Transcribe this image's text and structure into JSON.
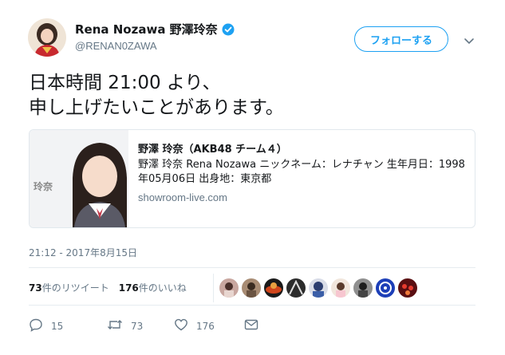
{
  "user": {
    "display_name": "Rena Nozawa 野澤玲奈",
    "handle": "@RENAN0ZAWA"
  },
  "follow_button": {
    "label": "フォローする"
  },
  "tweet": {
    "lines": [
      "日本時間 21:00 より、",
      "申し上げたいことがあります。"
    ]
  },
  "card": {
    "image_label": "玲奈",
    "title": "野澤 玲奈（AKB48 チーム４）",
    "description": "野澤 玲奈 Rena Nozawa ニックネーム：レナチャン 生年月日：1998年05月06日 出身地：東京都",
    "domain": "showroom-live.com"
  },
  "timestamp": "21:12 - 2017年8月15日",
  "stats": {
    "retweets_count": "73",
    "retweets_label": "件のリツイート",
    "likes_count": "176",
    "likes_label": "件のいいね"
  },
  "actions": {
    "reply_count": "15",
    "retweet_count": "73",
    "like_count": "176"
  },
  "colors": {
    "accent": "#1da1f2",
    "secondary_text": "#657786",
    "divider": "#e6ecf0"
  },
  "icons": [
    "verified-icon",
    "chevron-down-icon",
    "reply-icon",
    "retweet-icon",
    "like-icon",
    "message-icon"
  ]
}
